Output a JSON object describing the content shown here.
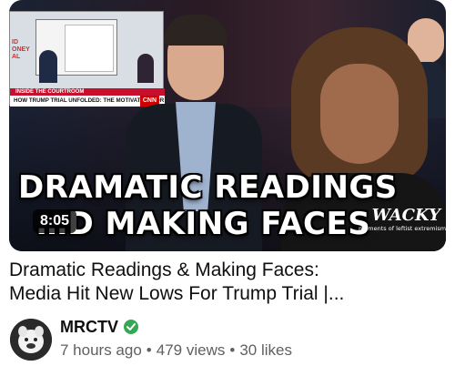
{
  "video": {
    "duration": "8:05",
    "thumbnail": {
      "headline_line1": "DRAMATIC READINGS",
      "headline_line2": "…D MAKING FACES",
      "wacky_brand": "WACKY",
      "wacky_tagline": "moments of leftist extremism",
      "inset": {
        "side_text_1": "ID",
        "side_text_2": "ONEY",
        "side_text_3": "AL",
        "banner_top": "INSIDE THE COURTROOM",
        "banner": "HOW TRUMP TRIAL UNFOLDED: THE MOTIVATION FOR THE PAYMENT",
        "network": "CNN"
      }
    },
    "title_line1": "Dramatic Readings & Making Faces:",
    "title_line2": "Media Hit New Lows For Trump Trial |...",
    "channel": {
      "name": "MRCTV",
      "verified_icon": "verified-check-icon",
      "verified_color": "#34a853"
    },
    "posted": "7 hours ago",
    "views": "479 views",
    "likes": "30 likes",
    "separator": "•"
  }
}
